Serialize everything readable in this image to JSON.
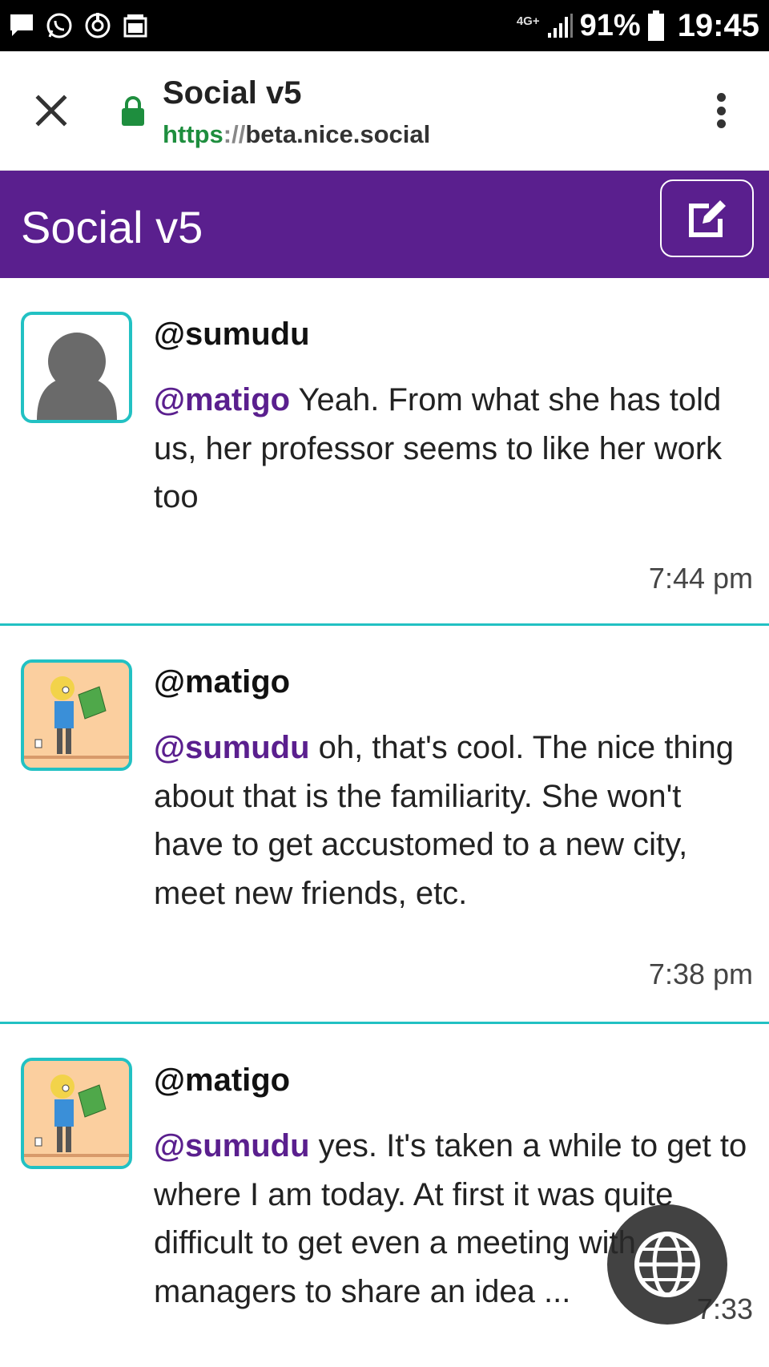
{
  "status_bar": {
    "network": "4G+",
    "battery_percent": "91%",
    "time": "19:45"
  },
  "browser": {
    "page_title": "Social v5",
    "url_scheme": "https",
    "url_separator": "://",
    "url_host": "beta.nice.social"
  },
  "app": {
    "title": "Social v5"
  },
  "posts": [
    {
      "username": "@sumudu",
      "mention": "@matigo",
      "text": " Yeah. From what she has told us, her professor seems to like her work too",
      "time": "7:44 pm",
      "avatar": "default-person"
    },
    {
      "username": "@matigo",
      "mention": "@sumudu",
      "text": " oh, that's cool. The nice thing about that is the familiarity. She won't have to get accustomed to a new city, meet new friends, etc.",
      "time": "7:38 pm",
      "avatar": "cartoon-reader"
    },
    {
      "username": "@matigo",
      "mention": "@sumudu",
      "text": " yes. It's taken a while to get to where I am today. At first it was quite difficult to get even a meeting with managers to share an idea ...",
      "time": "7:33",
      "avatar": "cartoon-reader"
    }
  ],
  "icons": {
    "close": "close-icon",
    "lock": "lock-icon",
    "menu": "more-vert-icon",
    "compose": "edit-icon",
    "globe": "globe-icon"
  },
  "colors": {
    "brand_purple": "#5a1f8e",
    "accent_teal": "#22c1c3",
    "secure_green": "#1e8e3e"
  }
}
